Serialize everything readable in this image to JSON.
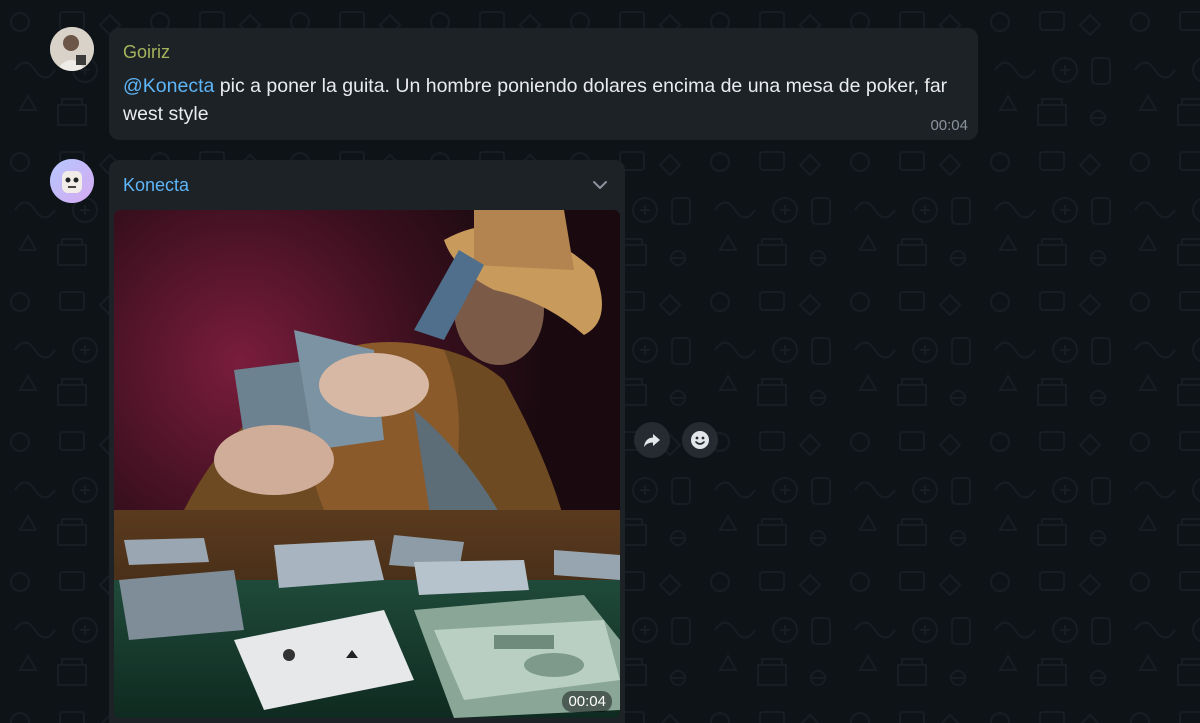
{
  "messages": [
    {
      "sender": "Goiriz",
      "mention": "@Konecta",
      "text": " pic a poner la guita. Un hombre poniendo dolares encima de una mesa de poker, far west style",
      "time": "00:04"
    },
    {
      "sender": "Konecta",
      "photo_time": "00:04"
    }
  ],
  "colors": {
    "background": "#0e1318",
    "bubble": "#1d2227",
    "sender_goiriz": "#a5b35b",
    "sender_konecta": "#5eb5f7",
    "mention": "#5eb5f7"
  },
  "icons": {
    "menu": "chevron-down-icon",
    "forward": "forward-arrow-icon",
    "react": "smiley-icon"
  }
}
